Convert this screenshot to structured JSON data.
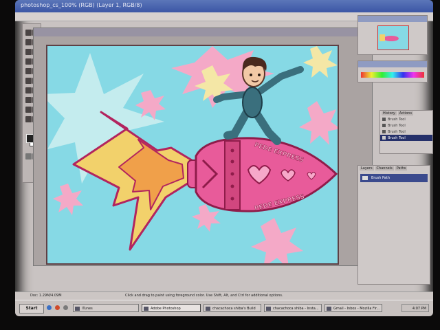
{
  "window": {
    "title": "photoshop_cs_100% (RGB) (Layer 1, RGB/8)"
  },
  "canvas_art": {
    "rocket_text_top": "PEDE EXPRESS",
    "rocket_text_bottom": "PEDE EXPRESS"
  },
  "colors": {
    "canvas_bg": "#86d9e5",
    "rocket_pink": "#e85b9a",
    "flame_yellow": "#f2d16b",
    "flame_orange": "#f0a04a",
    "burst_pink": "#f4a9c7",
    "burst_yellow": "#f4e7a6",
    "suit_teal": "#3a6f7d"
  },
  "panels": {
    "history": {
      "tabs": [
        "History",
        "Actions"
      ],
      "items": [
        "Brush Tool",
        "Brush Tool",
        "Brush Tool",
        "Brush Tool"
      ],
      "selected_index": 3
    },
    "layers": {
      "tabs": [
        "Layers",
        "Channels",
        "Paths"
      ],
      "layer_name": "Brush Path"
    }
  },
  "status": {
    "doc_info": "Doc: 1.29M/4.09M",
    "hint": "Click and drag to paint using foreground color. Use Shift, Alt, and Ctrl for additional options."
  },
  "taskbar": {
    "start_label": "Start",
    "tasks": [
      {
        "label": "iTunes",
        "icon": "itunes-icon",
        "active": false
      },
      {
        "label": "Adobe Photoshop",
        "icon": "photoshop-icon",
        "active": true
      },
      {
        "label": "chacachoca shiba's Build",
        "icon": "window-icon",
        "active": false
      },
      {
        "label": "chacachoca shiba - Insta...",
        "icon": "window-icon",
        "active": false
      },
      {
        "label": "Gmail - Inbox - Mozilla Fir...",
        "icon": "firefox-icon",
        "active": false
      }
    ],
    "clock": "4:07 PM"
  }
}
